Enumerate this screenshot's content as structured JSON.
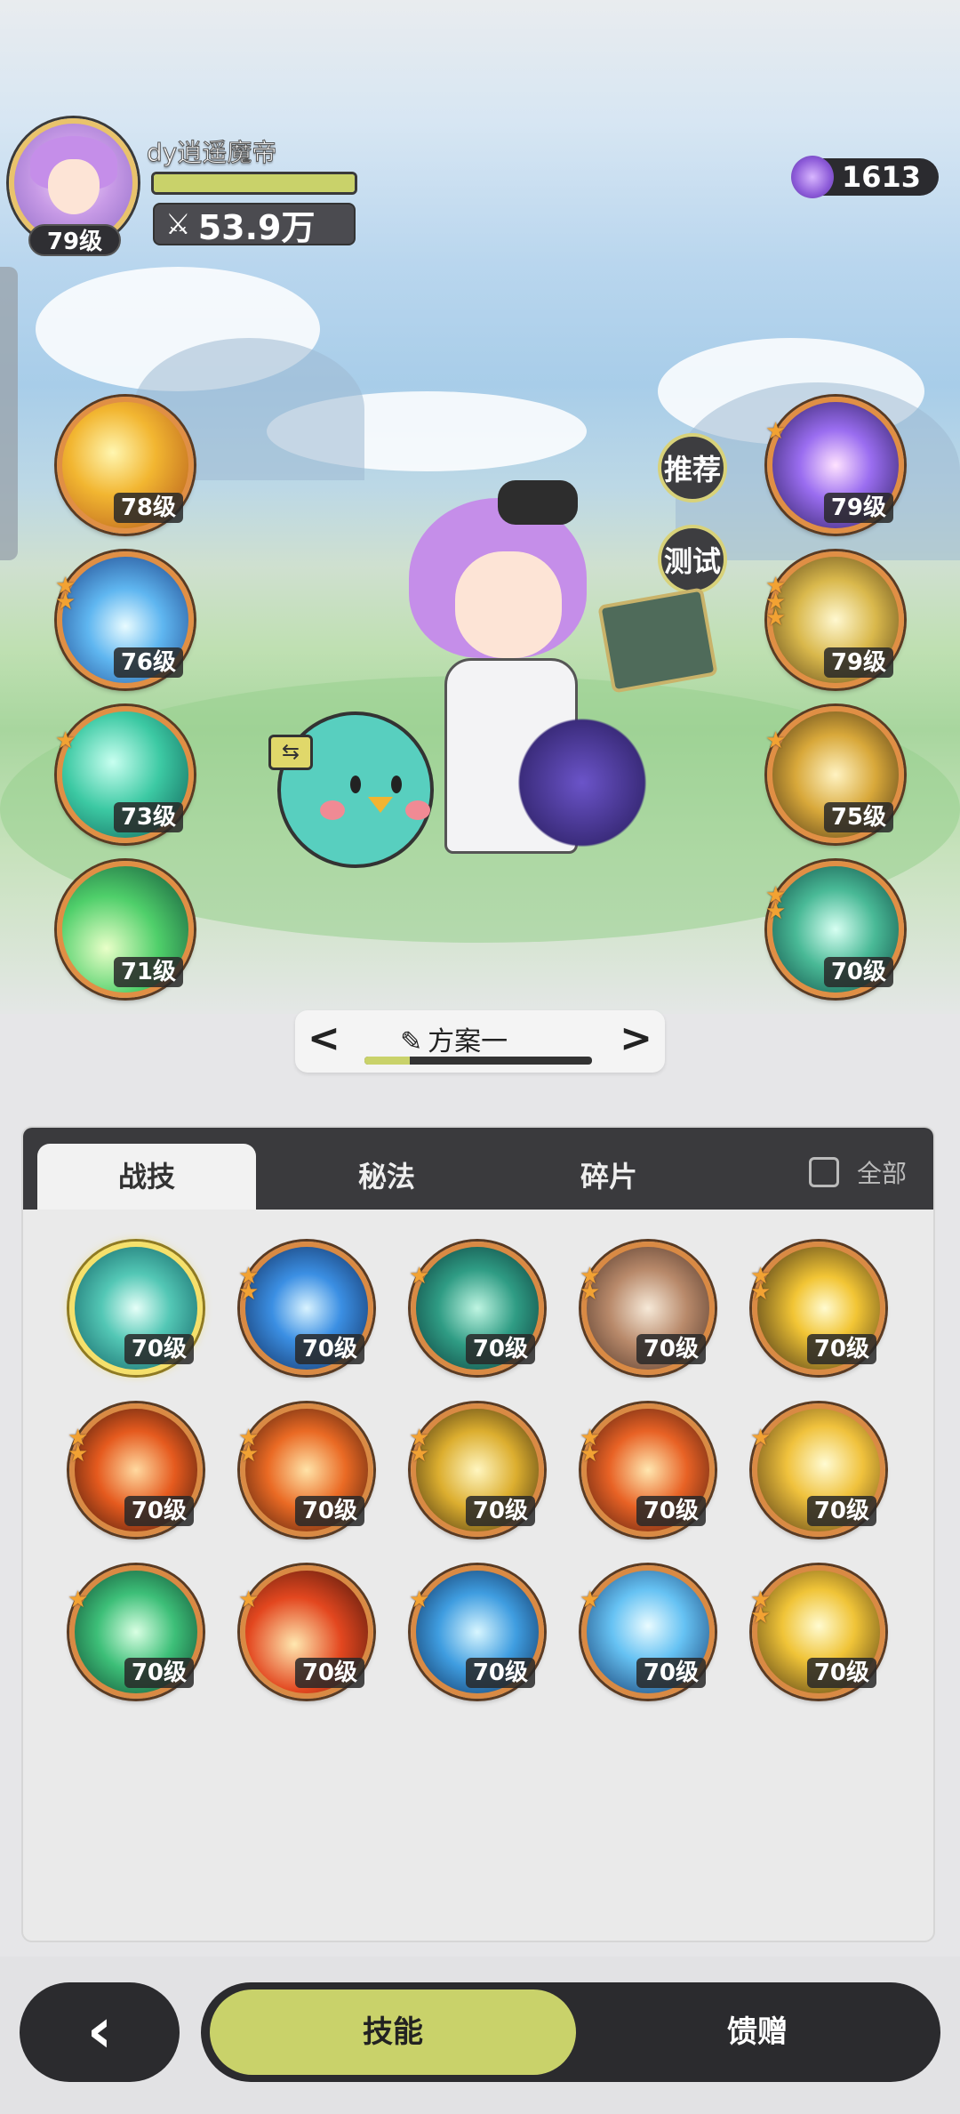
{
  "player": {
    "name": "dy逍遥魔帝",
    "level": "79级",
    "power": "53.9万",
    "exp_fraction": 1.0
  },
  "currency": {
    "value": "1613",
    "icon": "purple-gem-icon"
  },
  "side_buttons": {
    "recommend": "推荐",
    "test": "测试"
  },
  "equipped_left": [
    {
      "level": "78级",
      "stars": 0,
      "theme": "gold-star-slash"
    },
    {
      "level": "76级",
      "stars": 2,
      "theme": "ice-burst"
    },
    {
      "level": "73级",
      "stars": 1,
      "theme": "wind-blade"
    },
    {
      "level": "71级",
      "stars": 0,
      "theme": "green-meteor"
    }
  ],
  "equipped_right": [
    {
      "level": "79级",
      "stars": 1,
      "theme": "arcane-circle"
    },
    {
      "level": "79级",
      "stars": 3,
      "theme": "golden-flame"
    },
    {
      "level": "75级",
      "stars": 1,
      "theme": "golden-explosion"
    },
    {
      "level": "70级",
      "stars": 2,
      "theme": "jade-vortex"
    }
  ],
  "plan": {
    "label": "方案一",
    "progress": 0.2
  },
  "tabs": [
    {
      "label": "战技",
      "active": true
    },
    {
      "label": "秘法",
      "active": false
    },
    {
      "label": "碎片",
      "active": false
    }
  ],
  "filter_all": {
    "label": "全部",
    "checked": false
  },
  "skills": [
    {
      "level": "70级",
      "stars": 0,
      "theme": "teal-spiral",
      "highlight": true
    },
    {
      "level": "70级",
      "stars": 2,
      "theme": "blue-wave"
    },
    {
      "level": "70级",
      "stars": 1,
      "theme": "thorn-vine"
    },
    {
      "level": "70级",
      "stars": 2,
      "theme": "red-cards"
    },
    {
      "level": "70级",
      "stars": 2,
      "theme": "lightning-strike"
    },
    {
      "level": "70级",
      "stars": 2,
      "theme": "fire-swirl"
    },
    {
      "level": "70级",
      "stars": 2,
      "theme": "fire-eye"
    },
    {
      "level": "70级",
      "stars": 2,
      "theme": "gold-shards"
    },
    {
      "level": "70级",
      "stars": 2,
      "theme": "fire-orb"
    },
    {
      "level": "70级",
      "stars": 1,
      "theme": "gold-burst"
    },
    {
      "level": "70级",
      "stars": 1,
      "theme": "green-heal"
    },
    {
      "level": "70级",
      "stars": 1,
      "theme": "flame-pillar"
    },
    {
      "level": "70级",
      "stars": 1,
      "theme": "ice-shard"
    },
    {
      "level": "70级",
      "stars": 1,
      "theme": "ice-crystal"
    },
    {
      "level": "70级",
      "stars": 2,
      "theme": "sun-triangle"
    }
  ],
  "bottom_nav": {
    "back": "‹",
    "skill": "技能",
    "gift": "馈赠"
  },
  "colors": {
    "accent": "#c9d26a",
    "slot_border": "#e08f45",
    "dark": "#2b2b2e"
  }
}
